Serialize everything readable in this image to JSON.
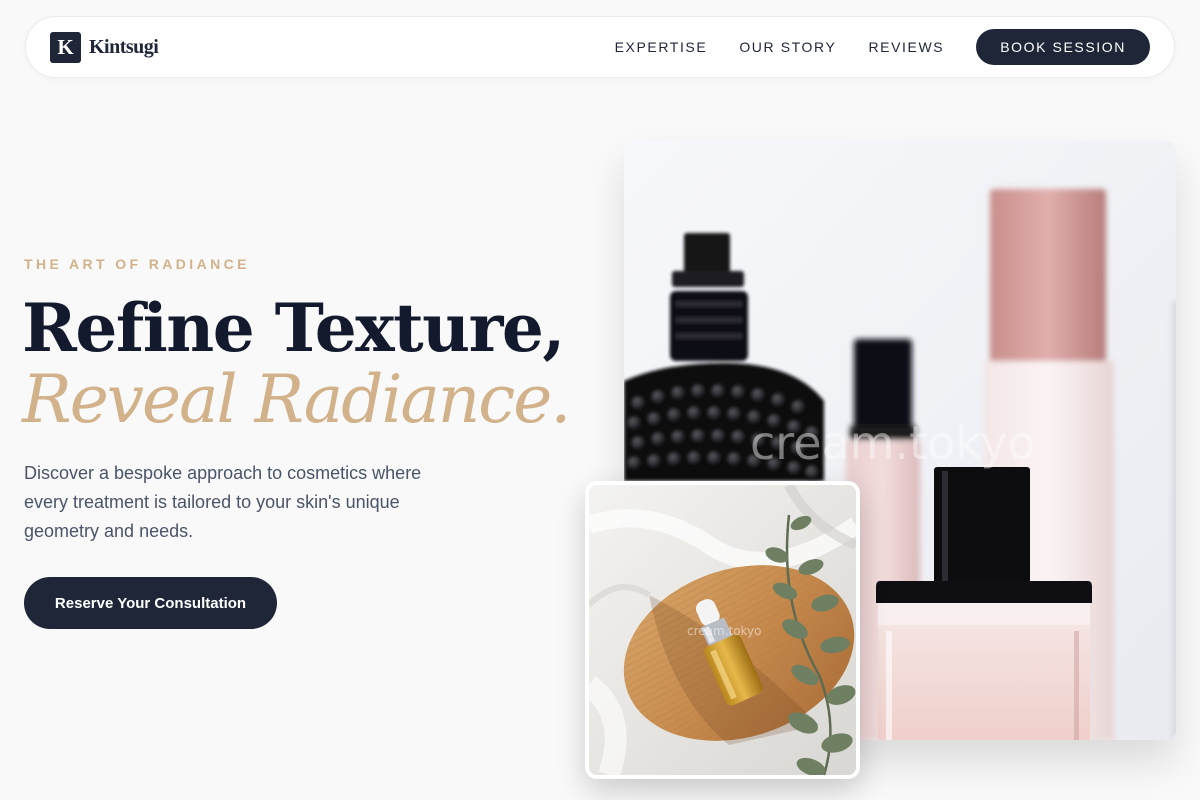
{
  "brand": {
    "mark": "K",
    "name": "Kintsugi"
  },
  "nav": {
    "links": [
      "EXPERTISE",
      "OUR STORY",
      "REVIEWS"
    ],
    "cta": "BOOK SESSION"
  },
  "hero": {
    "eyebrow": "THE ART OF RADIANCE",
    "headline": "Refine Texture,",
    "headline_accent": "Reveal Radiance.",
    "lede": "Discover a bespoke approach to cosmetics where every treatment is tailored to your skin's unique geometry and needs.",
    "cta": "Reserve Your Consultation"
  },
  "images": {
    "main": {
      "description": "perfume bottles",
      "watermark": "cream.tokyo"
    },
    "secondary": {
      "description": "serum bottle on wooden tray with eucalyptus",
      "watermark": "cream.tokyo"
    }
  },
  "colors": {
    "navy": "#1e2638",
    "gold": "#d1b28a",
    "background": "#f9f9f9",
    "body_text": "#4a5468"
  }
}
